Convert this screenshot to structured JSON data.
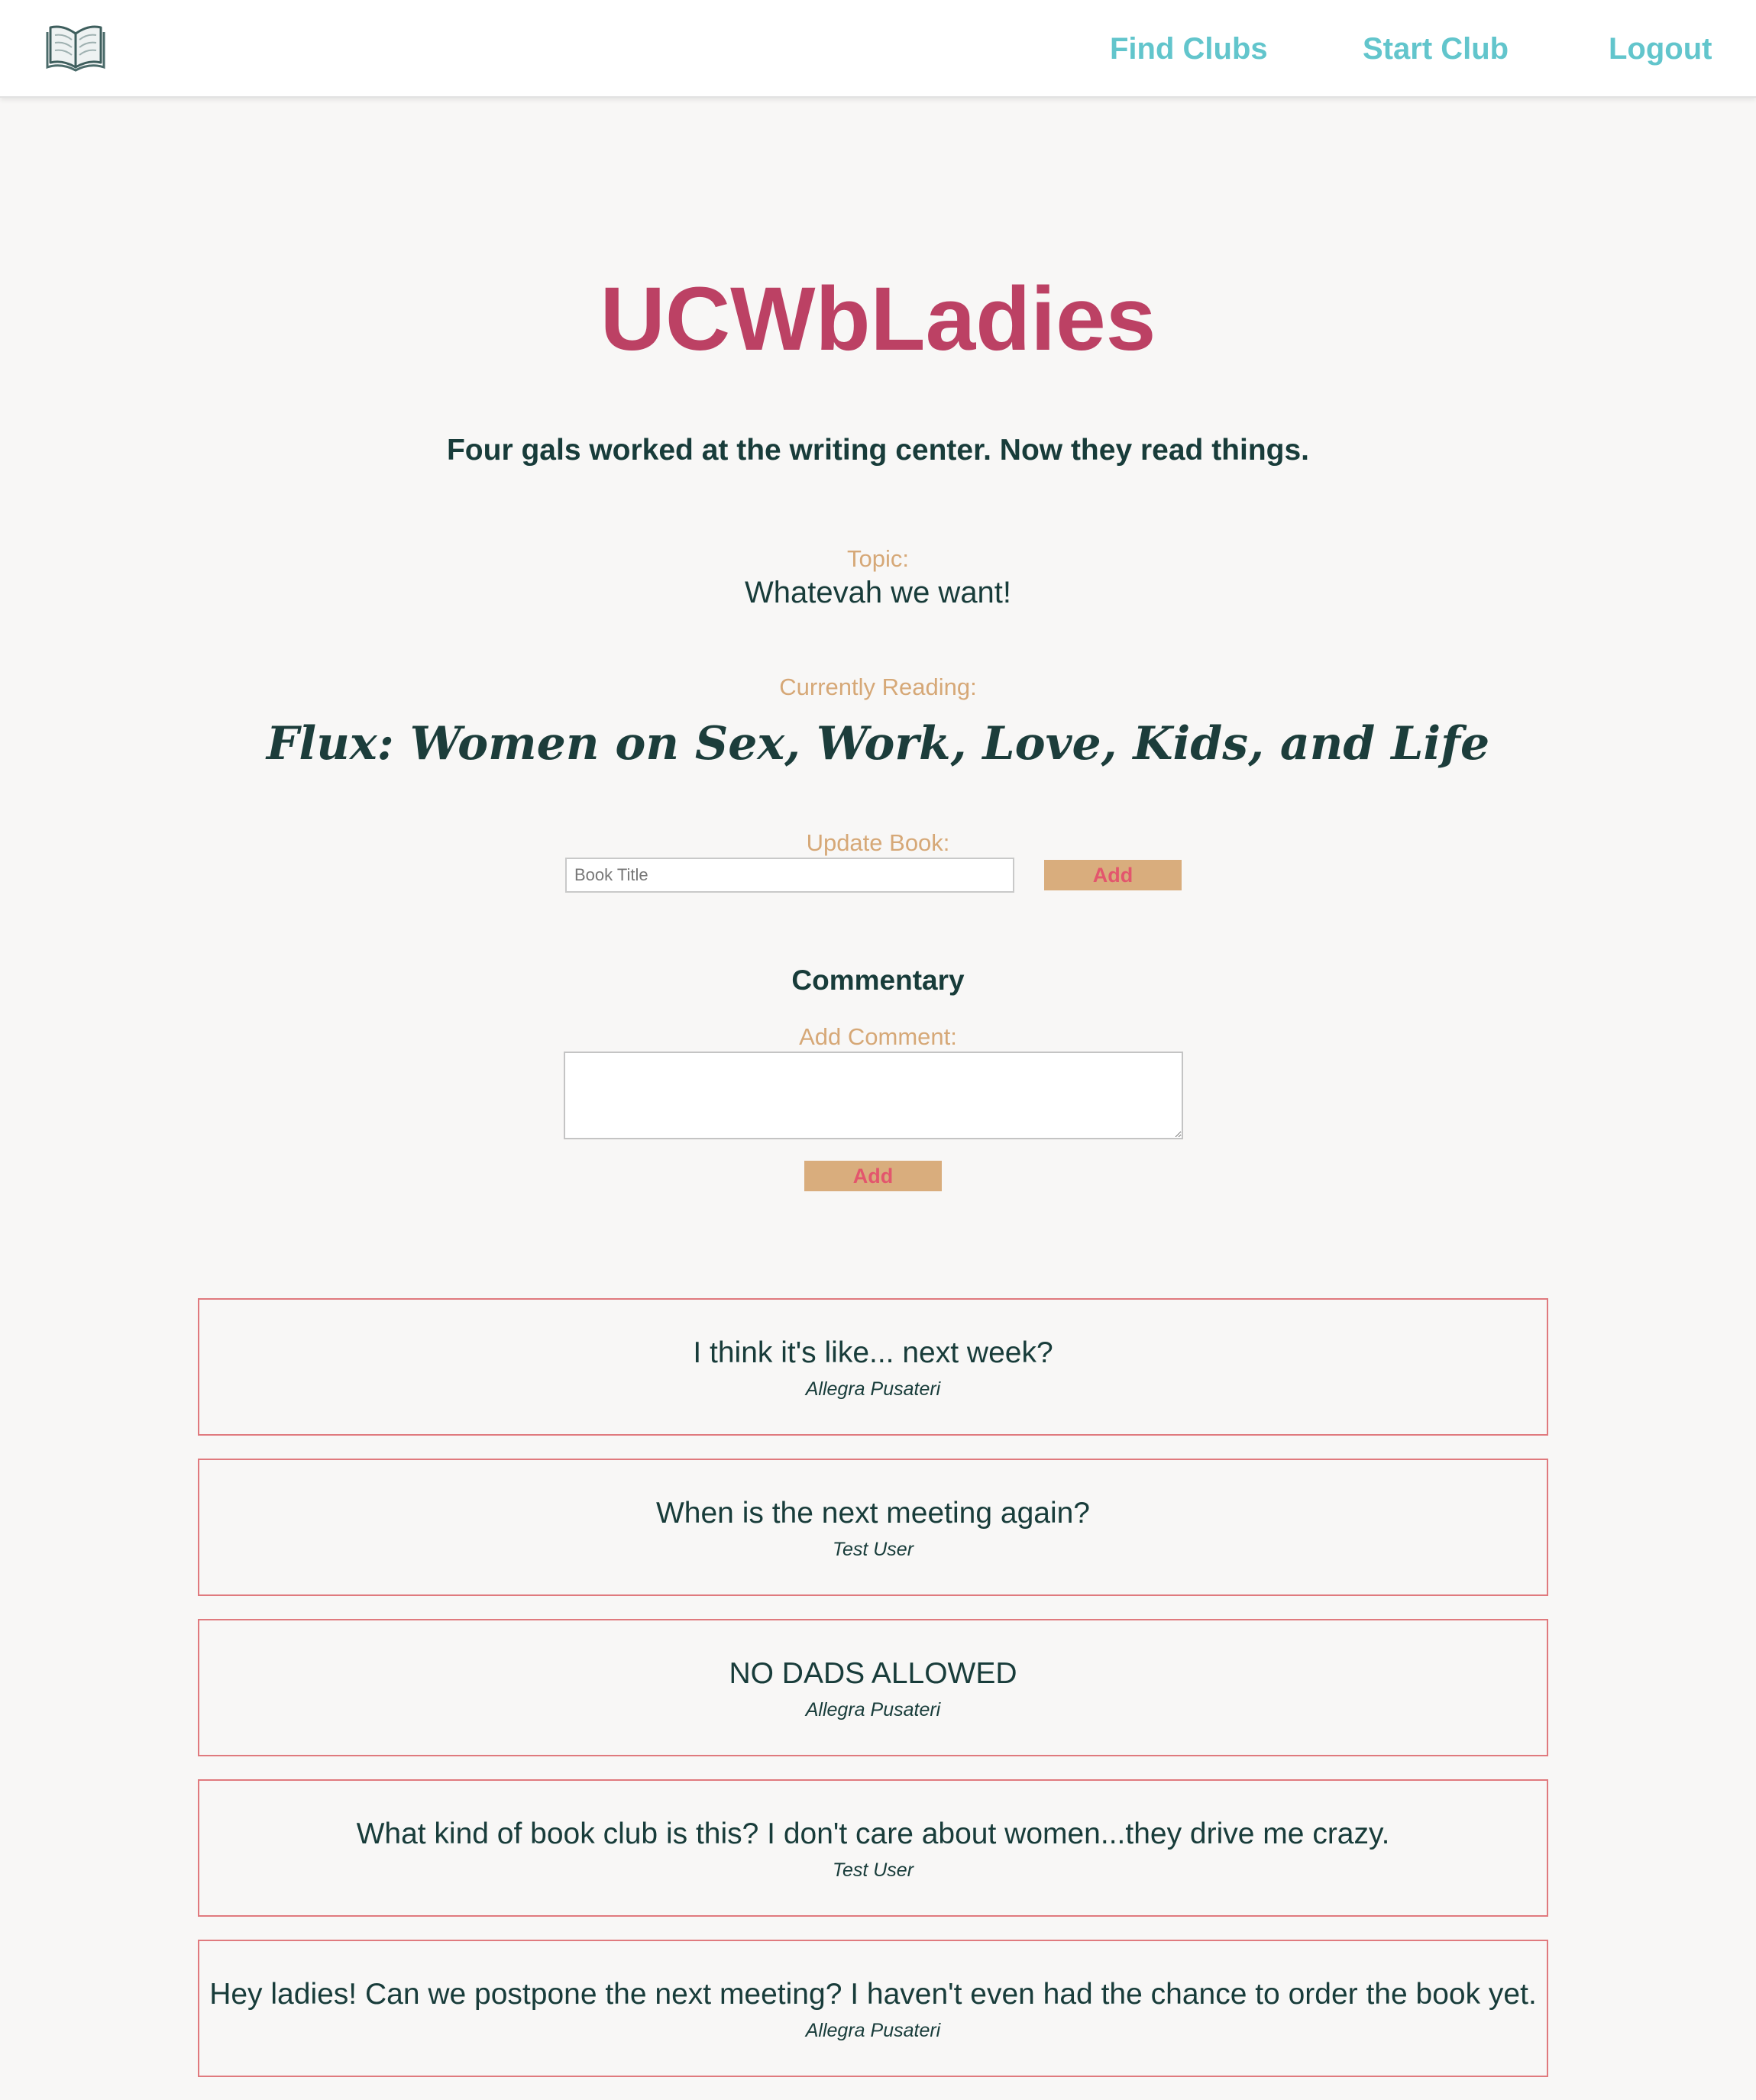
{
  "nav": {
    "logo_icon": "open-book-icon",
    "links": [
      {
        "label": "Find Clubs"
      },
      {
        "label": "Start Club"
      },
      {
        "label": "Logout"
      }
    ]
  },
  "club": {
    "name": "UCWbLadies",
    "description": "Four gals worked at the writing center. Now they read things.",
    "topic_label": "Topic:",
    "topic": "Whatevah we want!",
    "reading_label": "Currently Reading:",
    "current_book": "Flux: Women on Sex, Work, Love, Kids, and Life"
  },
  "update_book": {
    "label": "Update Book:",
    "placeholder": "Book Title",
    "button_label": "Add"
  },
  "commentary": {
    "heading": "Commentary",
    "add_label": "Add Comment:",
    "button_label": "Add",
    "comments": [
      {
        "text": "I think it's like... next week?",
        "author": "Allegra Pusateri"
      },
      {
        "text": "When is the next meeting again?",
        "author": "Test User"
      },
      {
        "text": "NO DADS ALLOWED",
        "author": "Allegra Pusateri"
      },
      {
        "text": "What kind of book club is this? I don't care about women...they drive me crazy.",
        "author": "Test User"
      },
      {
        "text": "Hey ladies! Can we postpone the next meeting? I haven't even had the chance to order the book yet.",
        "author": "Allegra Pusateri"
      }
    ]
  },
  "colors": {
    "accent_teal": "#62c5cc",
    "title_rose": "#bc4164",
    "label_gold": "#d6a877",
    "button_bg": "#d9ad7d",
    "card_border": "#e07a7e"
  }
}
